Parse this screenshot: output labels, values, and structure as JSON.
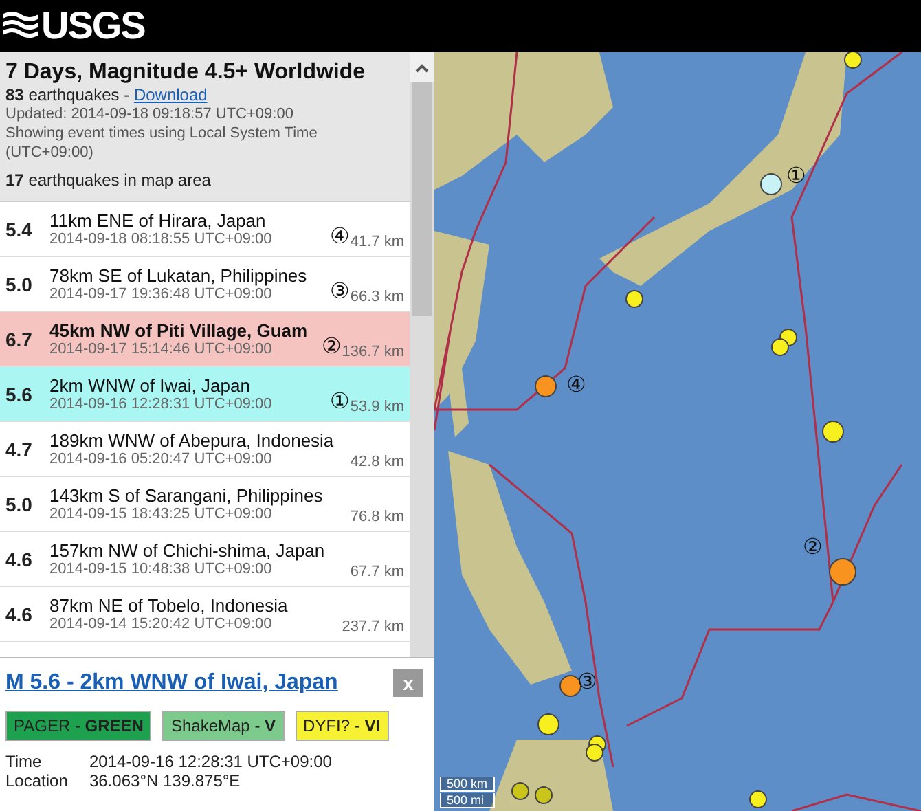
{
  "header": {
    "logo_text": "USGS"
  },
  "feed": {
    "title": "7 Days, Magnitude 4.5+ Worldwide",
    "count": "83",
    "count_label": "earthquakes -",
    "download_link": "Download",
    "updated": "Updated: 2014-09-18 09:18:57 UTC+09:00",
    "time_note": "Showing event times using Local System Time (UTC+09:00)",
    "map_count": "17",
    "map_count_label": "earthquakes in map area"
  },
  "events": [
    {
      "magnitude": "5.4",
      "place": "11km ENE of Hirara, Japan",
      "time": "2014-09-18 08:18:55 UTC+09:00",
      "marker": "④",
      "depth": "41.7 km",
      "selected": false,
      "hovered": false
    },
    {
      "magnitude": "5.0",
      "place": "78km SE of Lukatan, Philippines",
      "time": "2014-09-17 19:36:48 UTC+09:00",
      "marker": "③",
      "depth": "66.3 km",
      "selected": false,
      "hovered": false
    },
    {
      "magnitude": "6.7",
      "place": "45km NW of Piti Village, Guam",
      "time": "2014-09-17 15:14:46 UTC+09:00",
      "marker": "②",
      "depth": "136.7 km",
      "selected": false,
      "hovered": true
    },
    {
      "magnitude": "5.6",
      "place": "2km WNW of Iwai, Japan",
      "time": "2014-09-16 12:28:31 UTC+09:00",
      "marker": "①",
      "depth": "53.9 km",
      "selected": true,
      "hovered": false
    },
    {
      "magnitude": "4.7",
      "place": "189km WNW of Abepura, Indonesia",
      "time": "2014-09-16 05:20:47 UTC+09:00",
      "depth": "42.8 km",
      "selected": false,
      "hovered": false
    },
    {
      "magnitude": "5.0",
      "place": "143km S of Sarangani, Philippines",
      "time": "2014-09-15 18:43:25 UTC+09:00",
      "depth": "76.8 km",
      "selected": false,
      "hovered": false
    },
    {
      "magnitude": "4.6",
      "place": "157km NW of Chichi-shima, Japan",
      "time": "2014-09-15 10:48:38 UTC+09:00",
      "depth": "67.7 km",
      "selected": false,
      "hovered": false
    },
    {
      "magnitude": "4.6",
      "place": "87km NE of Tobelo, Indonesia",
      "time": "2014-09-14 15:20:42 UTC+09:00",
      "depth": "237.7 km",
      "selected": false,
      "hovered": false
    }
  ],
  "popup": {
    "title": "M 5.6 - 2km WNW of Iwai, Japan",
    "close": "x",
    "badges": [
      {
        "label": "PAGER -",
        "value": "GREEN",
        "color": "#1ea14f"
      },
      {
        "label": "ShakeMap -",
        "value": "V",
        "color": "#7ccb8c"
      },
      {
        "label": "DYFI? -",
        "value": "VI",
        "color": "#f6f233"
      }
    ],
    "details": [
      {
        "label": "Time",
        "value": "2014-09-16 12:28:31 UTC+09:00"
      },
      {
        "label": "Location",
        "value": "36.063°N 139.875°E"
      }
    ]
  },
  "map": {
    "markers": [
      {
        "kind": "medium",
        "color": "#f8ef1e"
      },
      {
        "kind": "large",
        "color": "#c8f2f6"
      },
      {
        "kind": "medium",
        "color": "#f8ef1e"
      },
      {
        "kind": "medium",
        "color": "#f8ef1e"
      },
      {
        "kind": "medium",
        "color": "#f8ef1e"
      },
      {
        "kind": "large",
        "color": "#f7931e"
      },
      {
        "kind": "large",
        "color": "#f8ef1e"
      },
      {
        "kind": "xlarge",
        "color": "#f7931e"
      },
      {
        "kind": "large",
        "color": "#f7931e"
      },
      {
        "kind": "large",
        "color": "#f8ef1e"
      },
      {
        "kind": "medium",
        "color": "#f8ef1e"
      },
      {
        "kind": "medium",
        "color": "#f8ef1e"
      },
      {
        "kind": "medium",
        "color": "#c9c51a"
      },
      {
        "kind": "medium",
        "color": "#c9c51a"
      },
      {
        "kind": "medium",
        "color": "#f8ef1e"
      }
    ],
    "labels": [
      "①",
      "④",
      "②",
      "③"
    ],
    "scale": [
      "500 km",
      "500 mi"
    ]
  }
}
